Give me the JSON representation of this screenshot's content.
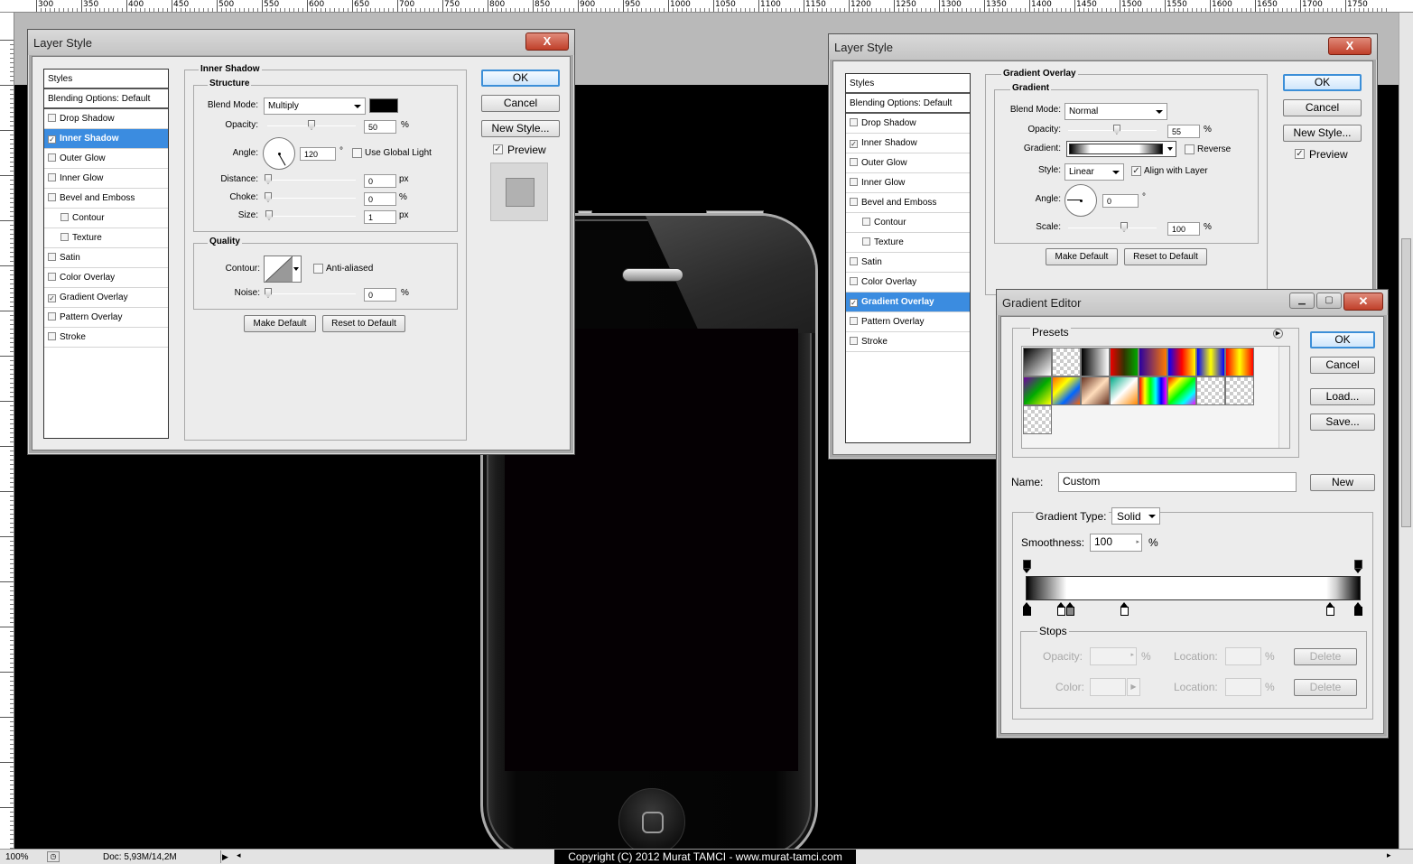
{
  "ruler": {
    "top_labels": [
      "300",
      "350",
      "400",
      "450",
      "500",
      "550",
      "600",
      "650",
      "700",
      "750",
      "800",
      "850",
      "900",
      "950",
      "1000",
      "1050",
      "1100",
      "1150",
      "1200",
      "1250",
      "1300",
      "1350",
      "1400",
      "1450",
      "1500",
      "1550",
      "1600",
      "1650",
      "1700",
      "1750"
    ]
  },
  "status_bar": {
    "zoom": "100%",
    "doc": "Doc: 5,93M/14,2M",
    "copyright": "Copyright (C) 2012 Murat TAMCI - www.murat-tamci.com"
  },
  "layer_style_left": {
    "title": "Layer Style",
    "close_label": "X",
    "styles_header": "Styles",
    "blending_options": "Blending Options: Default",
    "items": [
      {
        "label": "Drop Shadow",
        "checked": false,
        "sub": false,
        "selected": false
      },
      {
        "label": "Inner Shadow",
        "checked": true,
        "sub": false,
        "selected": true
      },
      {
        "label": "Outer Glow",
        "checked": false,
        "sub": false,
        "selected": false
      },
      {
        "label": "Inner Glow",
        "checked": false,
        "sub": false,
        "selected": false
      },
      {
        "label": "Bevel and Emboss",
        "checked": false,
        "sub": false,
        "selected": false
      },
      {
        "label": "Contour",
        "checked": false,
        "sub": true,
        "selected": false
      },
      {
        "label": "Texture",
        "checked": false,
        "sub": true,
        "selected": false
      },
      {
        "label": "Satin",
        "checked": false,
        "sub": false,
        "selected": false
      },
      {
        "label": "Color Overlay",
        "checked": false,
        "sub": false,
        "selected": false
      },
      {
        "label": "Gradient Overlay",
        "checked": true,
        "sub": false,
        "selected": false
      },
      {
        "label": "Pattern Overlay",
        "checked": false,
        "sub": false,
        "selected": false
      },
      {
        "label": "Stroke",
        "checked": false,
        "sub": false,
        "selected": false
      }
    ],
    "section_title": "Inner Shadow",
    "structure_title": "Structure",
    "blend_mode_label": "Blend Mode:",
    "blend_mode_value": "Multiply",
    "opacity_label": "Opacity:",
    "opacity_value": "50",
    "opacity_fraction": 0.5,
    "percent": "%",
    "angle_label": "Angle:",
    "angle_value": "120",
    "degree": "°",
    "use_global_light": "Use Global Light",
    "distance_label": "Distance:",
    "distance_value": "0",
    "choke_label": "Choke:",
    "choke_value": "0",
    "size_label": "Size:",
    "size_value": "1",
    "px": "px",
    "quality_title": "Quality",
    "contour_label": "Contour:",
    "anti_aliased": "Anti-aliased",
    "noise_label": "Noise:",
    "noise_value": "0",
    "make_default": "Make Default",
    "reset_to_default": "Reset to Default",
    "ok": "OK",
    "cancel": "Cancel",
    "new_style": "New Style...",
    "preview": "Preview",
    "shadow_color": "#000000"
  },
  "layer_style_right": {
    "title": "Layer Style",
    "close_label": "X",
    "styles_header": "Styles",
    "blending_options": "Blending Options: Default",
    "items": [
      {
        "label": "Drop Shadow",
        "checked": false,
        "sub": false,
        "selected": false
      },
      {
        "label": "Inner Shadow",
        "checked": true,
        "sub": false,
        "selected": false
      },
      {
        "label": "Outer Glow",
        "checked": false,
        "sub": false,
        "selected": false
      },
      {
        "label": "Inner Glow",
        "checked": false,
        "sub": false,
        "selected": false
      },
      {
        "label": "Bevel and Emboss",
        "checked": false,
        "sub": false,
        "selected": false
      },
      {
        "label": "Contour",
        "checked": false,
        "sub": true,
        "selected": false
      },
      {
        "label": "Texture",
        "checked": false,
        "sub": true,
        "selected": false
      },
      {
        "label": "Satin",
        "checked": false,
        "sub": false,
        "selected": false
      },
      {
        "label": "Color Overlay",
        "checked": false,
        "sub": false,
        "selected": false
      },
      {
        "label": "Gradient Overlay",
        "checked": true,
        "sub": false,
        "selected": true
      },
      {
        "label": "Pattern Overlay",
        "checked": false,
        "sub": false,
        "selected": false
      },
      {
        "label": "Stroke",
        "checked": false,
        "sub": false,
        "selected": false
      }
    ],
    "section_title": "Gradient Overlay",
    "gradient_title": "Gradient",
    "blend_mode_label": "Blend Mode:",
    "blend_mode_value": "Normal",
    "opacity_label": "Opacity:",
    "opacity_value": "55",
    "opacity_fraction": 0.55,
    "percent": "%",
    "gradient_label": "Gradient:",
    "reverse": "Reverse",
    "style_label": "Style:",
    "style_value": "Linear",
    "align_with_layer": "Align with Layer",
    "angle_label": "Angle:",
    "angle_value": "0",
    "degree": "°",
    "scale_label": "Scale:",
    "scale_value": "100",
    "make_default": "Make Default",
    "reset_to_default": "Reset to Default",
    "ok": "OK",
    "cancel": "Cancel",
    "new_style": "New Style...",
    "preview": "Preview"
  },
  "gradient_editor": {
    "title": "Gradient Editor",
    "presets_label": "Presets",
    "ok": "OK",
    "cancel": "Cancel",
    "load": "Load...",
    "save": "Save...",
    "name_label": "Name:",
    "name_value": "Custom",
    "new": "New",
    "gradient_type_label": "Gradient Type:",
    "gradient_type_value": "Solid",
    "smoothness_label": "Smoothness:",
    "smoothness_value": "100",
    "percent": "%",
    "stops_label": "Stops",
    "opacity_label": "Opacity:",
    "location_label": "Location:",
    "color_label": "Color:",
    "delete": "Delete"
  },
  "colors": {
    "selection": "#3b8ce0",
    "dialog_bg": "#ececec",
    "close_red": "#c0402a"
  }
}
